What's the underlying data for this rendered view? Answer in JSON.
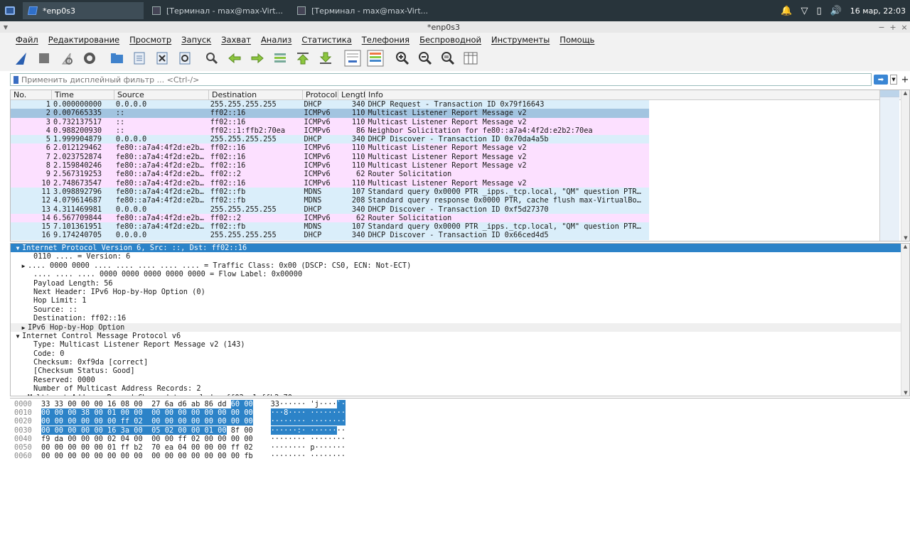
{
  "taskbar": {
    "tasks": [
      {
        "label": "*enp0s3",
        "active": true
      },
      {
        "label": "[Терминал - max@max-Virt...",
        "active": false
      },
      {
        "label": "[Терминал - max@max-Virt...",
        "active": false
      }
    ],
    "clock": "16 мар, 22:03"
  },
  "window": {
    "title": "*enp0s3"
  },
  "menu": [
    "Файл",
    "Редактирование",
    "Просмотр",
    "Запуск",
    "Захват",
    "Анализ",
    "Статистика",
    "Телефония",
    "Беспроводной",
    "Инструменты",
    "Помощь"
  ],
  "toolbar_icons": [
    "shark-fin-start-icon",
    "stop-capture-icon",
    "restart-capture-icon",
    "capture-options-icon",
    "open-file-icon",
    "save-file-icon",
    "close-file-icon",
    "reload-file-icon",
    "find-packet-icon",
    "go-back-icon",
    "go-forward-icon",
    "go-to-packet-icon",
    "first-packet-icon",
    "last-packet-icon",
    "autoscroll-icon",
    "colorize-icon",
    "zoom-in-icon",
    "zoom-out-icon",
    "zoom-normal-icon",
    "resize-columns-icon"
  ],
  "filter": {
    "placeholder": "Применить дисплейный фильтр ... <Ctrl-/>"
  },
  "columns": [
    "No.",
    "Time",
    "Source",
    "Destination",
    "Protocol",
    "Length",
    "Info"
  ],
  "colors": {
    "udp": "#daeefa",
    "icmp": "#fce0ff",
    "selected": "#a2c4e0",
    "select_blue": "#2c83c8"
  },
  "packets": [
    {
      "no": "1",
      "time": "0.000000000",
      "src": "0.0.0.0",
      "dst": "255.255.255.255",
      "proto": "DHCP",
      "len": "340",
      "info": "DHCP Request  - Transaction ID 0x79f16643",
      "kind": "udp"
    },
    {
      "no": "2",
      "time": "0.007665335",
      "src": "::",
      "dst": "ff02::16",
      "proto": "ICMPv6",
      "len": "110",
      "info": "Multicast Listener Report Message v2",
      "kind": "selected"
    },
    {
      "no": "3",
      "time": "0.732137517",
      "src": "::",
      "dst": "ff02::16",
      "proto": "ICMPv6",
      "len": "110",
      "info": "Multicast Listener Report Message v2",
      "kind": "icmp"
    },
    {
      "no": "4",
      "time": "0.988200930",
      "src": "::",
      "dst": "ff02::1:ffb2:70ea",
      "proto": "ICMPv6",
      "len": "86",
      "info": "Neighbor Solicitation for fe80::a7a4:4f2d:e2b2:70ea",
      "kind": "icmp"
    },
    {
      "no": "5",
      "time": "1.999904879",
      "src": "0.0.0.0",
      "dst": "255.255.255.255",
      "proto": "DHCP",
      "len": "340",
      "info": "DHCP Discover - Transaction ID 0x70da4a5b",
      "kind": "udp"
    },
    {
      "no": "6",
      "time": "2.012129462",
      "src": "fe80::a7a4:4f2d:e2b…",
      "dst": "ff02::16",
      "proto": "ICMPv6",
      "len": "110",
      "info": "Multicast Listener Report Message v2",
      "kind": "icmp"
    },
    {
      "no": "7",
      "time": "2.023752874",
      "src": "fe80::a7a4:4f2d:e2b…",
      "dst": "ff02::16",
      "proto": "ICMPv6",
      "len": "110",
      "info": "Multicast Listener Report Message v2",
      "kind": "icmp"
    },
    {
      "no": "8",
      "time": "2.159840246",
      "src": "fe80::a7a4:4f2d:e2b…",
      "dst": "ff02::16",
      "proto": "ICMPv6",
      "len": "110",
      "info": "Multicast Listener Report Message v2",
      "kind": "icmp"
    },
    {
      "no": "9",
      "time": "2.567319253",
      "src": "fe80::a7a4:4f2d:e2b…",
      "dst": "ff02::2",
      "proto": "ICMPv6",
      "len": "62",
      "info": "Router Solicitation",
      "kind": "icmp"
    },
    {
      "no": "10",
      "time": "2.748673547",
      "src": "fe80::a7a4:4f2d:e2b…",
      "dst": "ff02::16",
      "proto": "ICMPv6",
      "len": "110",
      "info": "Multicast Listener Report Message v2",
      "kind": "icmp"
    },
    {
      "no": "11",
      "time": "3.098892796",
      "src": "fe80::a7a4:4f2d:e2b…",
      "dst": "ff02::fb",
      "proto": "MDNS",
      "len": "107",
      "info": "Standard query 0x0000 PTR _ipps._tcp.local, \"QM\" question PTR…",
      "kind": "udp"
    },
    {
      "no": "12",
      "time": "4.079614687",
      "src": "fe80::a7a4:4f2d:e2b…",
      "dst": "ff02::fb",
      "proto": "MDNS",
      "len": "208",
      "info": "Standard query response 0x0000 PTR, cache flush max-VirtualBo…",
      "kind": "udp"
    },
    {
      "no": "13",
      "time": "4.311469981",
      "src": "0.0.0.0",
      "dst": "255.255.255.255",
      "proto": "DHCP",
      "len": "340",
      "info": "DHCP Discover - Transaction ID 0xf5d27370",
      "kind": "udp"
    },
    {
      "no": "14",
      "time": "6.567709844",
      "src": "fe80::a7a4:4f2d:e2b…",
      "dst": "ff02::2",
      "proto": "ICMPv6",
      "len": "62",
      "info": "Router Solicitation",
      "kind": "icmp"
    },
    {
      "no": "15",
      "time": "7.101361951",
      "src": "fe80::a7a4:4f2d:e2b…",
      "dst": "ff02::fb",
      "proto": "MDNS",
      "len": "107",
      "info": "Standard query 0x0000 PTR _ipps._tcp.local, \"QM\" question PTR…",
      "kind": "udp"
    },
    {
      "no": "16",
      "time": "9.174240705",
      "src": "0.0.0.0",
      "dst": "255.255.255.255",
      "proto": "DHCP",
      "len": "340",
      "info": "DHCP Discover - Transaction ID 0x66ced4d5",
      "kind": "udp"
    }
  ],
  "details": [
    {
      "indent": 0,
      "arrow": "down",
      "text": "Internet Protocol Version 6, Src: ::, Dst: ff02::16",
      "style": "sel"
    },
    {
      "indent": 2,
      "arrow": "",
      "text": "0110 .... = Version: 6",
      "style": ""
    },
    {
      "indent": 1,
      "arrow": "right",
      "text": ".... 0000 0000 .... .... .... .... .... = Traffic Class: 0x00 (DSCP: CS0, ECN: Not-ECT)",
      "style": ""
    },
    {
      "indent": 2,
      "arrow": "",
      "text": ".... .... .... 0000 0000 0000 0000 0000 = Flow Label: 0x00000",
      "style": ""
    },
    {
      "indent": 2,
      "arrow": "",
      "text": "Payload Length: 56",
      "style": ""
    },
    {
      "indent": 2,
      "arrow": "",
      "text": "Next Header: IPv6 Hop-by-Hop Option (0)",
      "style": ""
    },
    {
      "indent": 2,
      "arrow": "",
      "text": "Hop Limit: 1",
      "style": ""
    },
    {
      "indent": 2,
      "arrow": "",
      "text": "Source: ::",
      "style": ""
    },
    {
      "indent": 2,
      "arrow": "",
      "text": "Destination: ff02::16",
      "style": ""
    },
    {
      "indent": 1,
      "arrow": "right",
      "text": "IPv6 Hop-by-Hop Option",
      "style": "shade"
    },
    {
      "indent": 0,
      "arrow": "down",
      "text": "Internet Control Message Protocol v6",
      "style": ""
    },
    {
      "indent": 2,
      "arrow": "",
      "text": "Type: Multicast Listener Report Message v2 (143)",
      "style": ""
    },
    {
      "indent": 2,
      "arrow": "",
      "text": "Code: 0",
      "style": ""
    },
    {
      "indent": 2,
      "arrow": "",
      "text": "Checksum: 0xf9da [correct]",
      "style": ""
    },
    {
      "indent": 2,
      "arrow": "",
      "text": "[Checksum Status: Good]",
      "style": ""
    },
    {
      "indent": 2,
      "arrow": "",
      "text": "Reserved: 0000",
      "style": ""
    },
    {
      "indent": 2,
      "arrow": "",
      "text": "Number of Multicast Address Records: 2",
      "style": ""
    },
    {
      "indent": 1,
      "arrow": "right",
      "text": "Multicast Address Record Changed to exclude: ff02::1:ffb2:70ea",
      "style": ""
    }
  ],
  "bytes": [
    {
      "off": "0000",
      "hex": "33 33 00 00 00 16 08 00  27 6a d6 ab 86 dd 60 00",
      "ascii": "33······ 'j····`·",
      "hl": [
        [
          14,
          16
        ]
      ]
    },
    {
      "off": "0010",
      "hex": "00 00 00 38 00 01 00 00  00 00 00 00 00 00 00 00",
      "ascii": "···8···· ········",
      "hl": [
        [
          0,
          16
        ]
      ]
    },
    {
      "off": "0020",
      "hex": "00 00 00 00 00 00 ff 02  00 00 00 00 00 00 00 00",
      "ascii": "········ ········",
      "hl": [
        [
          0,
          16
        ]
      ]
    },
    {
      "off": "0030",
      "hex": "00 00 00 00 00 16 3a 00  05 02 00 00 01 00 8f 00",
      "ascii": "······:· ········",
      "hl": [
        [
          0,
          14
        ]
      ]
    },
    {
      "off": "0040",
      "hex": "f9 da 00 00 00 02 04 00  00 00 ff 02 00 00 00 00",
      "ascii": "········ ········",
      "hl": []
    },
    {
      "off": "0050",
      "hex": "00 00 00 00 00 01 ff b2  70 ea 04 00 00 00 ff 02",
      "ascii": "········ p·······",
      "hl": []
    },
    {
      "off": "0060",
      "hex": "00 00 00 00 00 00 00 00  00 00 00 00 00 00 00 fb",
      "ascii": "········ ········",
      "hl": []
    }
  ]
}
